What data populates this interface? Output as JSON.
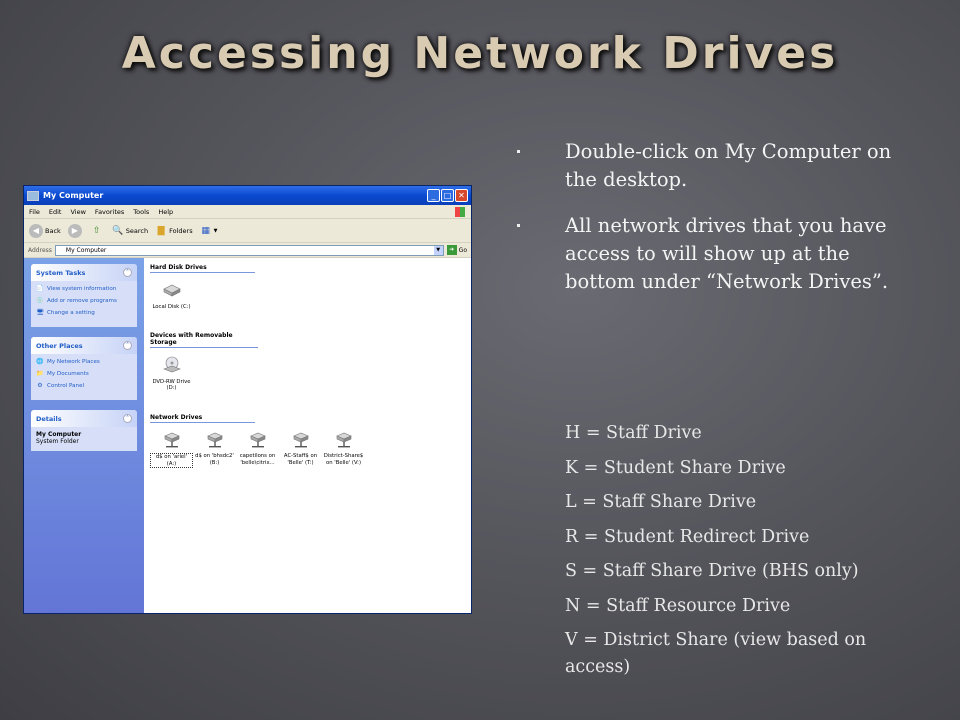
{
  "slide": {
    "title": "Accessing Network Drives",
    "bullets": [
      "Double-click on My Computer on the desktop.",
      "All network drives that you have access to will show up at the bottom under “Network Drives”."
    ],
    "drive_letters": [
      "H = Staff Drive",
      "K = Student Share Drive",
      "L = Staff Share Drive",
      "R = Student Redirect Drive",
      "S = Staff Share Drive (BHS only)",
      "N = Staff Resource Drive",
      "V = District Share (view based on access)"
    ]
  },
  "window": {
    "title": "My Computer",
    "menu": [
      "File",
      "Edit",
      "View",
      "Favorites",
      "Tools",
      "Help"
    ],
    "toolbar": {
      "back": "Back",
      "search": "Search",
      "folders": "Folders"
    },
    "address": {
      "label": "Address",
      "value": "My Computer",
      "go": "Go"
    },
    "panels": {
      "system_tasks": {
        "title": "System Tasks",
        "links": [
          "View system information",
          "Add or remove programs",
          "Change a setting"
        ]
      },
      "other_places": {
        "title": "Other Places",
        "links": [
          "My Network Places",
          "My Documents",
          "Control Panel"
        ]
      },
      "details": {
        "title": "Details",
        "name": "My Computer",
        "sub": "System Folder"
      }
    },
    "sections": {
      "hard_disk": {
        "title": "Hard Disk Drives",
        "items": [
          "Local Disk (C:)"
        ]
      },
      "removable": {
        "title": "Devices with Removable Storage",
        "items": [
          "DVD-RW Drive (D:)"
        ]
      },
      "network": {
        "title": "Network Drives",
        "items": [
          "d$ on 'ariel' (A:)",
          "d$ on 'bhsdc2' (B:)",
          "capetilons on 'belle\\citrix...",
          "AC-Staff$ on 'Belle' (T:)",
          "District-Share$ on 'Belle' (V:)"
        ]
      }
    }
  },
  "colors": {
    "title_text": "#d8cbb2",
    "xp_titlebar": "#0a4ad0",
    "task_pane": "#6375d6",
    "link": "#215dc6"
  }
}
